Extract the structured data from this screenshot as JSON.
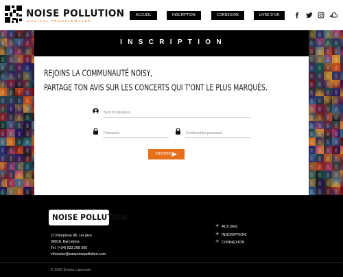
{
  "brand": {
    "title": "NOISE POLLUTION",
    "subtitle": "MUSICAL TROUBLEMAKER"
  },
  "nav": {
    "items": [
      {
        "label": "ACCUEIL"
      },
      {
        "label": "INSCRIPTION"
      },
      {
        "label": "CONNEXION"
      },
      {
        "label": "LIVRE D'OR"
      }
    ],
    "social_icons": [
      "facebook-icon",
      "twitter-icon",
      "instagram-icon",
      "soundcloud-icon"
    ]
  },
  "page": {
    "title": "INSCRIPTION",
    "intro_line1": "REJOINS LA COMMUNAUTÉ NOISY,",
    "intro_line2": "PARTAGE TON AVIS SUR LES CONCERTS QUI T'ONT LE PLUS MARQUÉS."
  },
  "form": {
    "username": {
      "placeholder": "Nom d'utilisateur",
      "value": "",
      "icon": "user-icon"
    },
    "password": {
      "placeholder": "Password",
      "value": "",
      "icon": "lock-icon"
    },
    "confirm_password": {
      "placeholder": "Confirmation password",
      "value": "",
      "icon": "lock-icon"
    },
    "submit_label": "ENVOYER",
    "submit_icon": "send-icon"
  },
  "footer": {
    "logo_text": "NOISE POLLUTION",
    "address_lines": [
      "C/ Pamplona 88, 1er piso",
      "08018, Barcelona",
      "Tel. (+34) 933 208 200",
      "infonoise@salanoisepollution.com"
    ],
    "links": [
      {
        "label": "ACCUEIL"
      },
      {
        "label": "INSCRIPTION"
      },
      {
        "label": "CONNEXION"
      }
    ],
    "copyright": "© 2020 Emma Laprevote"
  },
  "colors": {
    "accent": "#e8701a",
    "background": "#000000",
    "panel": "#ffffff"
  }
}
